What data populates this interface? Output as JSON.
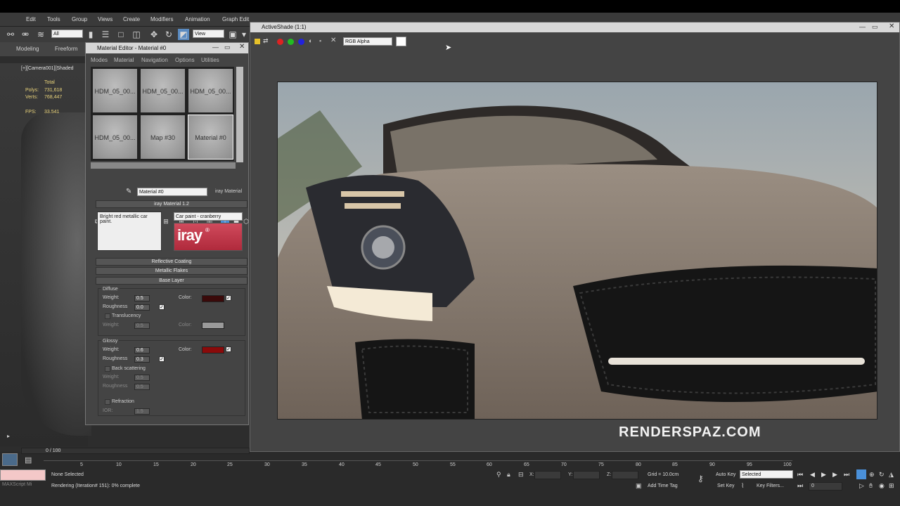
{
  "menu": {
    "items": [
      "Edit",
      "Tools",
      "Group",
      "Views",
      "Create",
      "Modifiers",
      "Animation",
      "Graph Edit"
    ]
  },
  "toolbar": {
    "filter_select": "All",
    "view_select": "View"
  },
  "ribbon": {
    "tabs": [
      "Modeling",
      "Freeform"
    ]
  },
  "viewport": {
    "label": "[+][Camera001][Shaded",
    "stats": {
      "total_label": "Total",
      "polys_label": "Polys:",
      "polys_value": "731,618",
      "verts_label": "Verts:",
      "verts_value": "768,447",
      "fps_label": "FPS:",
      "fps_value": "33.541"
    }
  },
  "material_editor": {
    "title": "Material Editor - Material #0",
    "menu": [
      "Modes",
      "Material",
      "Navigation",
      "Options",
      "Utilities"
    ],
    "slots": [
      "HDM_05_00...",
      "HDM_05_00...",
      "HDM_05_00...",
      "HDM_05_00...",
      "Map #30",
      "Material #0"
    ],
    "material_name": "Material #0",
    "material_type": "iray Material",
    "rollout_title": "iray Material 1.2",
    "description": "Bright red metallic car paint.",
    "preset_select": "Car paint - cranberry",
    "logo_text": "iray",
    "sections": {
      "reflective_coating": "Reflective Coating",
      "metallic_flakes": "Metallic Flakes",
      "base_layer": "Base Layer"
    },
    "diffuse": {
      "group": "Diffuse",
      "weight_label": "Weight:",
      "weight": "0.5",
      "roughness_label": "Roughness",
      "roughness": "0.0",
      "color_label": "Color:",
      "color": "#3a0a0a"
    },
    "translucency": {
      "label": "Translucency",
      "weight_label": "Weight:",
      "weight": "0.5",
      "color_label": "Color:",
      "color": "#9a9a9a"
    },
    "glossy": {
      "group": "Glossy",
      "weight_label": "Weight:",
      "weight": "0.6",
      "roughness_label": "Roughness",
      "roughness": "0.3",
      "color_label": "Color:",
      "color": "#8a0a0a"
    },
    "back_scattering": {
      "label": "Back scattering",
      "weight_label": "Weight:",
      "weight": "0.5",
      "roughness_label": "Roughness",
      "roughness": "0.5"
    },
    "refraction": {
      "label": "Refraction",
      "ior_label": "IOR:",
      "ior": "1.5"
    }
  },
  "activeshade": {
    "title": "ActiveShade (1:1)",
    "channel_select": "RGB Alpha"
  },
  "watermark": "RENDERSPAZ.COM",
  "timeline": {
    "frame_counter": "0 / 100",
    "ticks": [
      "5",
      "10",
      "15",
      "20",
      "25",
      "30",
      "35",
      "40",
      "45",
      "50",
      "55",
      "60",
      "65",
      "70",
      "75",
      "80",
      "85",
      "90",
      "95",
      "100"
    ]
  },
  "status": {
    "selection": "None Selected",
    "render": "Rendering (Iteration# 151): 0% complete",
    "maxscript": "MAXScript Mi",
    "x_label": "X:",
    "y_label": "Y:",
    "z_label": "Z:",
    "grid": "Grid = 10.0cm",
    "add_time_tag": "Add Time Tag",
    "auto_key": "Auto Key",
    "auto_key_select": "Selected",
    "set_key": "Set Key",
    "key_filters": "Key Filters...",
    "current_frame": "0"
  }
}
